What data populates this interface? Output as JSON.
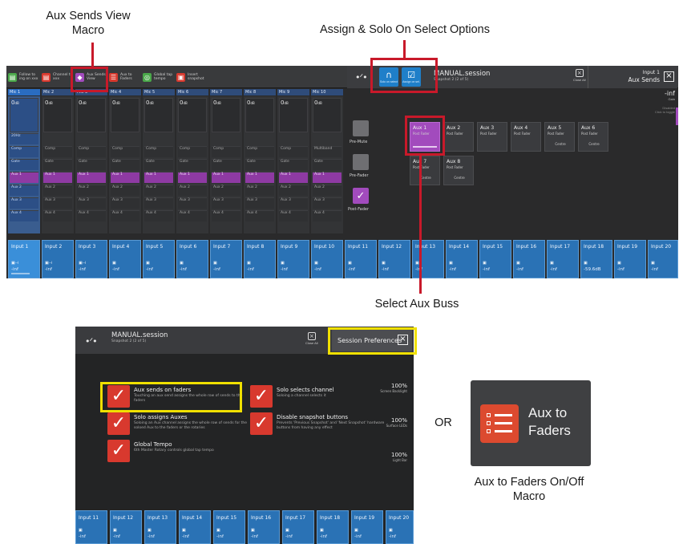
{
  "callouts": {
    "aux_sends_view": [
      "Aux Sends View",
      "Macro"
    ],
    "assign_solo": "Assign & Solo On Select Options",
    "select_aux": "Select Aux Buss",
    "or": "OR",
    "aux_to_faders": [
      "Aux to Faders On/Off",
      "Macro"
    ]
  },
  "colors": {
    "highlight_red": "#c8192a",
    "highlight_yellow": "#f0e000",
    "selected_purple": "#a24bbd",
    "fader_blue": "#2a72b5",
    "pref_check_red": "#d8392e"
  },
  "top_panel": {
    "macros": [
      {
        "icon": "bus-icon",
        "label": "Follow to ing on xxx"
      },
      {
        "icon": "channel-icon",
        "label": "Channel to xxx"
      },
      {
        "icon": "aux-sends-view-icon",
        "label": "Aux Sends View"
      },
      {
        "icon": "aux-to-faders-icon",
        "label": "Aux to Faders"
      },
      {
        "icon": "global-icon",
        "label": "Global tap tempo"
      },
      {
        "icon": "snapshot-icon",
        "label": "Insert snapshot"
      }
    ],
    "options": [
      {
        "icon": "headphones-icon",
        "label": "Solo on select"
      },
      {
        "icon": "check-icon",
        "label": "Assign on sel."
      }
    ],
    "session": {
      "title": "MANUAL.session",
      "subtitle": "Snapshot 2 (2 of 5)"
    },
    "close_all": "Close All",
    "panel_title": [
      "Input 1",
      "Aux Sends"
    ],
    "channels": [
      {
        "name": "Mic 1",
        "value": "0",
        "unit": "dB"
      },
      {
        "name": "Mic 2",
        "value": "0",
        "unit": "dB"
      },
      {
        "name": "Mic 3",
        "value": "0",
        "unit": "dB"
      },
      {
        "name": "Mic 4",
        "value": "0",
        "unit": "dB"
      },
      {
        "name": "Mic 5",
        "value": "0",
        "unit": "dB"
      },
      {
        "name": "Mic 6",
        "value": "0",
        "unit": "dB"
      },
      {
        "name": "Mic 7",
        "value": "0",
        "unit": "dB"
      },
      {
        "name": "Mic 8",
        "value": "0",
        "unit": "dB"
      },
      {
        "name": "Mic 9",
        "value": "0",
        "unit": "dB"
      },
      {
        "name": "Mic 10",
        "value": "0",
        "unit": "dB"
      }
    ],
    "strip_rows": [
      "Comp",
      "Gate",
      "Aux 1",
      "Aux 2",
      "Aux 3",
      "Aux 4"
    ],
    "multiband": "Multiband",
    "ch1_hz": "20Hz",
    "pre_mute": "Pre-Mute",
    "pre_fader": "Pre-Fader",
    "post_fader": "Post-Fader",
    "aux_buses": [
      {
        "name": "Aux 1",
        "mode": "Post Fader",
        "extra": ""
      },
      {
        "name": "Aux 2",
        "mode": "Post Fader",
        "extra": ""
      },
      {
        "name": "Aux 3",
        "mode": "Post Fader",
        "extra": ""
      },
      {
        "name": "Aux 4",
        "mode": "Post Fader",
        "extra": ""
      },
      {
        "name": "Aux 5",
        "mode": "Post Fader",
        "extra": "Centre"
      },
      {
        "name": "Aux 6",
        "mode": "Post Fader",
        "extra": "Centre"
      },
      {
        "name": "Aux 7",
        "mode": "Post Fader",
        "extra": "Centre"
      },
      {
        "name": "Aux 8",
        "mode": "Post Fader",
        "extra": "Centre"
      }
    ],
    "side_value": "-inf",
    "side_label": "Gain",
    "side_disabled": "Disabled",
    "side_hint": "Click to toggle",
    "inputs": [
      {
        "name": "Input 1",
        "value": "-inf"
      },
      {
        "name": "Input 2",
        "value": "-inf"
      },
      {
        "name": "Input 3",
        "value": "-inf"
      },
      {
        "name": "Input 4",
        "value": "-inf"
      },
      {
        "name": "Input 5",
        "value": "-inf"
      },
      {
        "name": "Input 6",
        "value": "-inf"
      },
      {
        "name": "Input 7",
        "value": "-inf"
      },
      {
        "name": "Input 8",
        "value": "-inf"
      },
      {
        "name": "Input 9",
        "value": "-inf"
      },
      {
        "name": "Input 10",
        "value": "-inf"
      },
      {
        "name": "Input 11",
        "value": "-inf"
      },
      {
        "name": "Input 12",
        "value": "-inf"
      },
      {
        "name": "Input 13",
        "value": "-inf"
      },
      {
        "name": "Input 14",
        "value": "-inf"
      },
      {
        "name": "Input 15",
        "value": "-inf"
      },
      {
        "name": "Input 16",
        "value": "-inf"
      },
      {
        "name": "Input 17",
        "value": "-inf"
      },
      {
        "name": "Input 18",
        "value": "-59.6dB"
      },
      {
        "name": "Input 19",
        "value": "-inf"
      },
      {
        "name": "Input 20",
        "value": "-inf"
      }
    ]
  },
  "bottom_panel": {
    "session": {
      "title": "MANUAL.session",
      "subtitle": "Snapshot 2 (2 of 5)"
    },
    "close_all": "Close All",
    "prefs_title": "Session Preferences",
    "prefs": [
      {
        "title": "Aux sends on faders",
        "desc": "Touching an aux send assigns the whole row of sends to the faders"
      },
      {
        "title": "Solo assigns Auxes",
        "desc": "Soloing an Aux channel assigns the whole row of sends for the soloed Aux to the faders or the rotaries"
      },
      {
        "title": "Global Tempo",
        "desc": "6th Master Rotary controls global tap tempo"
      },
      {
        "title": "Solo selects channel",
        "desc": "Soloing a channel selects it"
      },
      {
        "title": "Disable snapshot buttons",
        "desc": "Prevents 'Previous Snapshot' and 'Next Snapshot' hardware buttons from having any effect"
      }
    ],
    "levels": [
      {
        "value": "100%",
        "label": "Screen Backlight"
      },
      {
        "value": "100%",
        "label": "Surface LEDs"
      },
      {
        "value": "100%",
        "label": "Light Bar"
      }
    ],
    "inputs": [
      {
        "name": "Input 11",
        "value": "-inf"
      },
      {
        "name": "Input 12",
        "value": "-inf"
      },
      {
        "name": "Input 13",
        "value": "-inf"
      },
      {
        "name": "Input 14",
        "value": "-inf"
      },
      {
        "name": "Input 15",
        "value": "-inf"
      },
      {
        "name": "Input 16",
        "value": "-inf"
      },
      {
        "name": "Input 17",
        "value": "-inf"
      },
      {
        "name": "Input 18",
        "value": "-inf"
      },
      {
        "name": "Input 19",
        "value": "-inf"
      },
      {
        "name": "Input 20",
        "value": "-inf"
      }
    ]
  },
  "macro_tile": {
    "label": [
      "Aux to",
      "Faders"
    ],
    "icon": "checklist-icon"
  }
}
